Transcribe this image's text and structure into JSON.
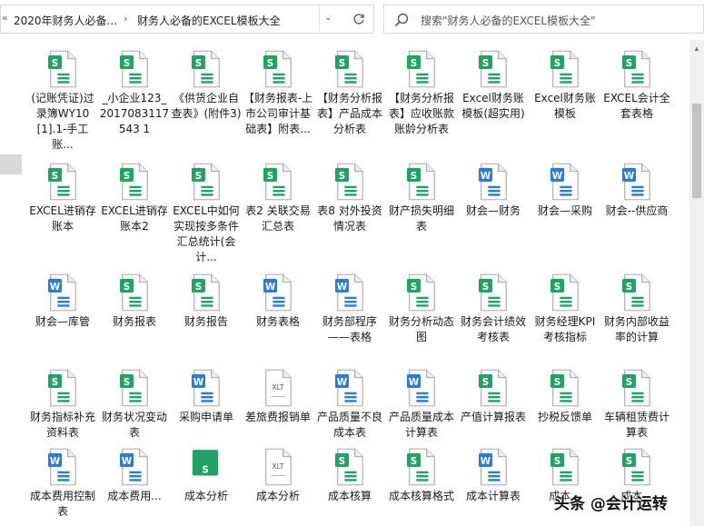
{
  "address_bar": {
    "back_glyph": "«",
    "crumbs": [
      "2020年财务人必备...",
      "财务人必备的EXCEL模板大全"
    ],
    "separator": "›",
    "dropdown_glyph": "⌄"
  },
  "search": {
    "placeholder": "搜索\"财务人必备的EXCEL模板大全\""
  },
  "watermark": {
    "text": "头条 @会计运转"
  },
  "colors": {
    "excel_green": "#21a366",
    "word_blue": "#2b7cd3",
    "doc_fill": "#ffffff",
    "doc_stroke": "#9a9a9a"
  },
  "files": [
    {
      "label": "(记账凭证)过录簿WY10[1].1-手工账...",
      "type": "excel"
    },
    {
      "label": "_小企业123_2017083117543 1",
      "type": "excel"
    },
    {
      "label": "《供货企业自查表》(附件3)",
      "type": "excel"
    },
    {
      "label": "【财务报表-上市公司审计基础表】附表...",
      "type": "excel"
    },
    {
      "label": "【财务分析报表】产品成本分析表",
      "type": "excel"
    },
    {
      "label": "【财务分析报表】应收账款账龄分析表",
      "type": "excel"
    },
    {
      "label": "Excel财务账模板(超实用)",
      "type": "excel"
    },
    {
      "label": "Excel财务账模板",
      "type": "excel"
    },
    {
      "label": "EXCEL会计全套表格",
      "type": "excel"
    },
    {
      "label": "EXCEL进销存账本",
      "type": "excel"
    },
    {
      "label": "EXCEL进销存账本2",
      "type": "excel"
    },
    {
      "label": "EXCEL中如何实现按多条件汇总统计(会计...",
      "type": "excel"
    },
    {
      "label": "表2 关联交易汇总表",
      "type": "excel"
    },
    {
      "label": "表8 对外投资情况表",
      "type": "excel"
    },
    {
      "label": "财产损失明细表",
      "type": "excel"
    },
    {
      "label": "财会—财务",
      "type": "word"
    },
    {
      "label": "财会—采购",
      "type": "word"
    },
    {
      "label": "财会--供应商",
      "type": "word"
    },
    {
      "label": "财会—库管",
      "type": "word"
    },
    {
      "label": "财务报表",
      "type": "excel"
    },
    {
      "label": "财务报告",
      "type": "excel"
    },
    {
      "label": "财务表格",
      "type": "word"
    },
    {
      "label": "财务部程序——表格",
      "type": "word"
    },
    {
      "label": "财务分析动态图",
      "type": "excel"
    },
    {
      "label": "财务会计绩效考核表",
      "type": "excel"
    },
    {
      "label": "财务经理KPI考核指标",
      "type": "excel"
    },
    {
      "label": "财务内部收益率的计算",
      "type": "excel"
    },
    {
      "label": "财务指标补充资料表",
      "type": "excel"
    },
    {
      "label": "财务状况变动表",
      "type": "excel"
    },
    {
      "label": "采购申请单",
      "type": "word"
    },
    {
      "label": "差旅费报销单",
      "type": "xlt",
      "badge": "XLT"
    },
    {
      "label": "产品质量不良成本表",
      "type": "word"
    },
    {
      "label": "产品质量成本计算表",
      "type": "word"
    },
    {
      "label": "产值计算报表",
      "type": "excel"
    },
    {
      "label": "抄税反馈单",
      "type": "excel"
    },
    {
      "label": "车辆租赁费计算表",
      "type": "excel"
    },
    {
      "label": "成本费用控制表",
      "type": "word"
    },
    {
      "label": "成本费用...",
      "type": "word"
    },
    {
      "label": "成本分析",
      "type": "excel-solid"
    },
    {
      "label": "成本分析",
      "type": "xlt",
      "badge": "XLT"
    },
    {
      "label": "成本核算",
      "type": "excel"
    },
    {
      "label": "成本核算格式",
      "type": "excel"
    },
    {
      "label": "成本计算表",
      "type": "word"
    },
    {
      "label": "成本...",
      "type": "excel"
    },
    {
      "label": "成本...",
      "type": "excel"
    }
  ]
}
